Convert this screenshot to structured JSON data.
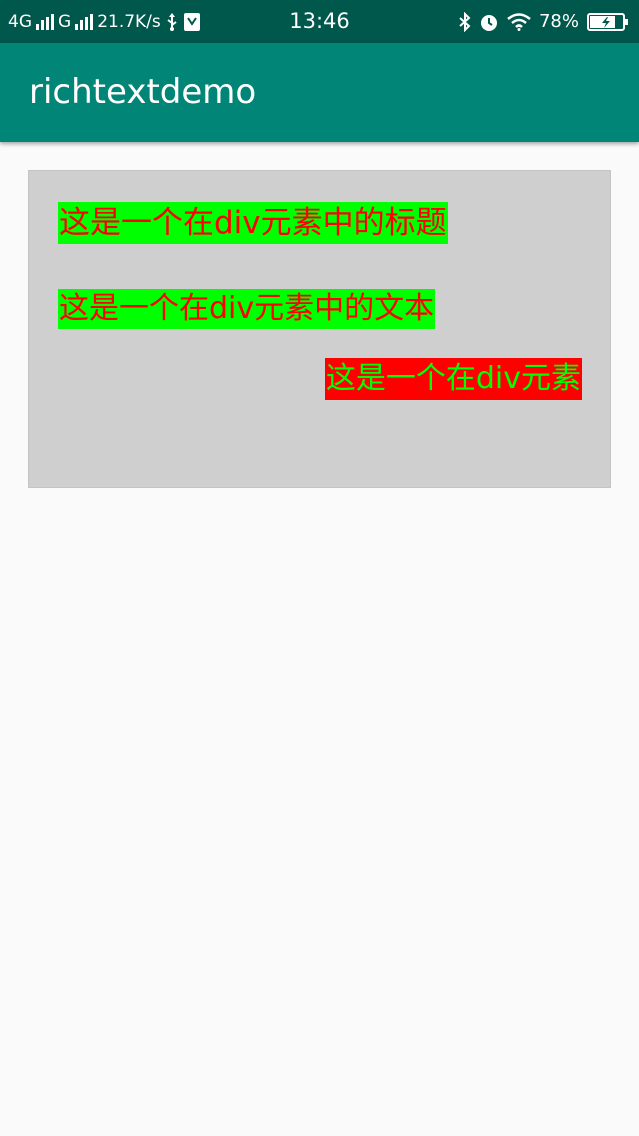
{
  "status_bar": {
    "network_1": "4G",
    "network_2": "G",
    "speed": "21.7K/s",
    "time": "13:46",
    "battery_percent": "78%",
    "battery_level": 0.78,
    "icons": [
      "signal-icon",
      "usb-icon",
      "sdcard-icon",
      "bluetooth-icon",
      "alarm-icon",
      "wifi-icon",
      "battery-icon"
    ]
  },
  "app_bar": {
    "title": "richtextdemo",
    "color": "#008577",
    "status_color": "#00574b"
  },
  "content": {
    "box_color": "#cfcfcf",
    "heading": {
      "text": "这是一个在div元素中的标题",
      "background": "#00ff00",
      "color": "#ff0000"
    },
    "paragraph": {
      "text": "这是一个在div元素中的文本",
      "background": "#00ff00",
      "color": "#ff0000"
    },
    "span": {
      "text": "这是一个在div元素",
      "background": "#ff0000",
      "color": "#00ff00"
    }
  }
}
